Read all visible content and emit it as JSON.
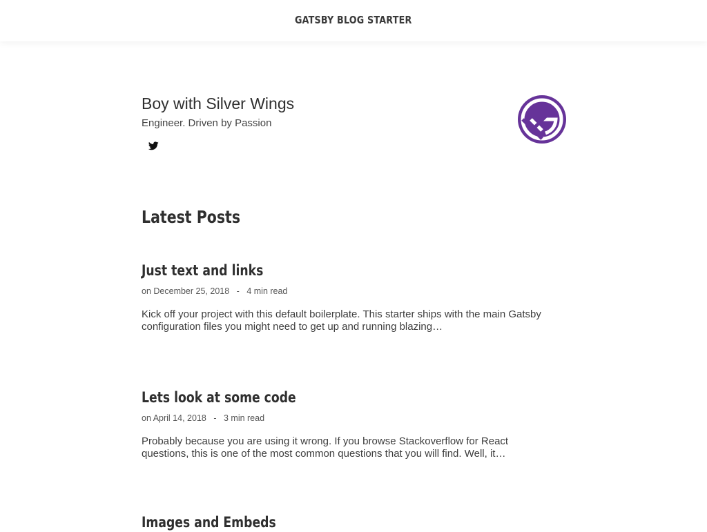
{
  "header": {
    "site_title": "GATSBY BLOG STARTER"
  },
  "profile": {
    "name": "Boy with Silver Wings",
    "tagline": "Engineer. Driven by Passion",
    "social_icon": "twitter-icon",
    "avatar_icon": "gatsby-logo",
    "avatar_color": "#663399"
  },
  "latest": {
    "heading": "Latest Posts",
    "posts": [
      {
        "title": "Just text and links",
        "date_prefix": "on",
        "date": "December 25, 2018",
        "separator": "-",
        "read_time": "4 min read",
        "excerpt": "Kick off your project with this default boilerplate. This starter ships with the main Gatsby configuration files you might need to get up and running blazing…"
      },
      {
        "title": "Lets look at some code",
        "date_prefix": "on",
        "date": "April 14, 2018",
        "separator": "-",
        "read_time": "3 min read",
        "excerpt": "Probably because you are using it wrong. If you browse Stackoverflow for React questions, this is one of the most common questions that you will find. Well, it…"
      },
      {
        "title": "Images and Embeds"
      }
    ]
  }
}
